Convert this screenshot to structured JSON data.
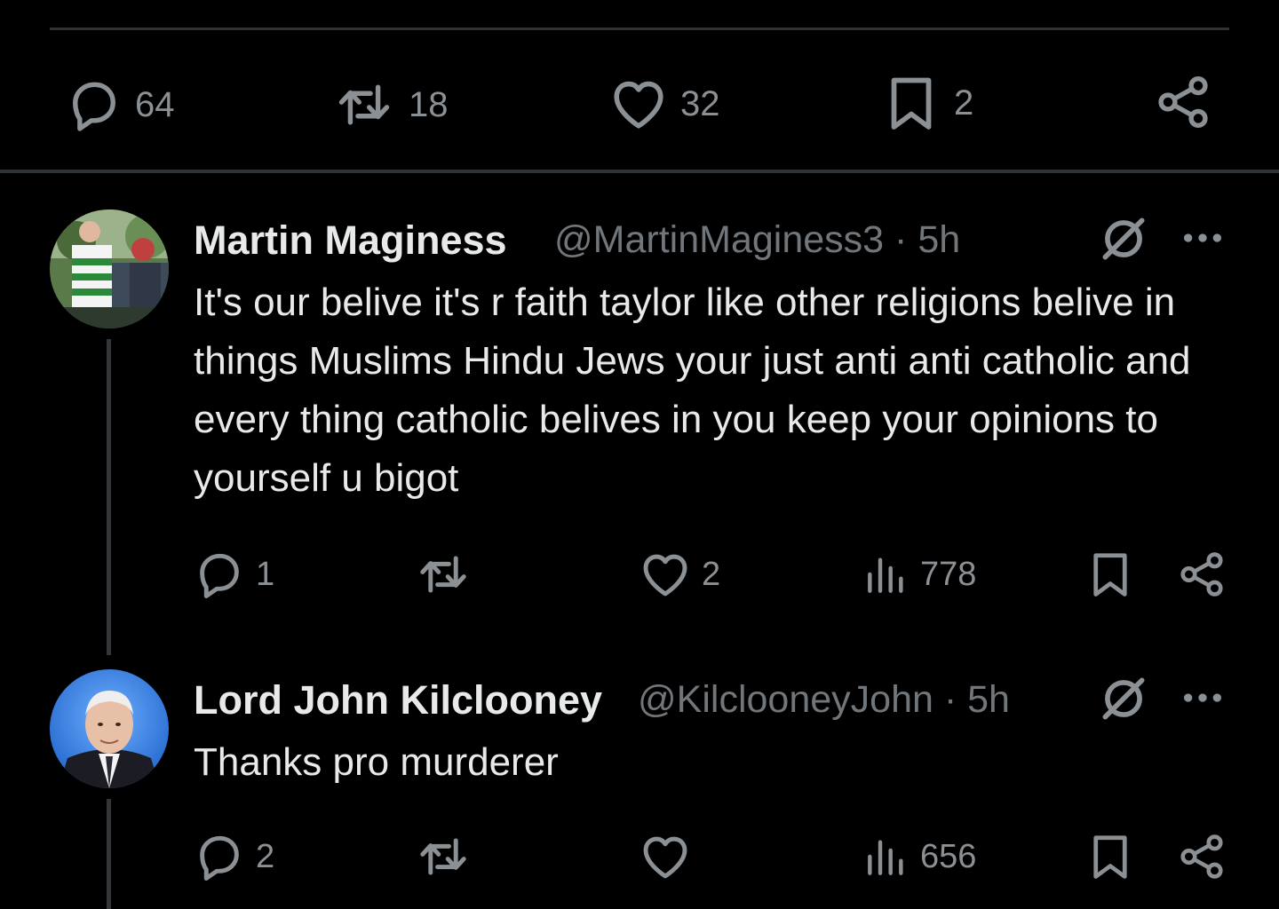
{
  "main_tweet_actions": {
    "replies": "64",
    "reposts": "18",
    "likes": "32",
    "bookmarks": "2"
  },
  "replies": [
    {
      "display_name": "Martin Maginess",
      "handle": "@MartinMaginess3",
      "separator": "·",
      "time": "5h",
      "text": "It's our belive it's r faith taylor like other religions belive in things Muslims Hindu Jews your just anti anti catholic and every thing catholic belives in you keep your opinions to yourself u bigot",
      "reply_count": "1",
      "repost_count": "",
      "like_count": "2",
      "view_count": "778"
    },
    {
      "display_name": "Lord John Kilclooney",
      "handle": "@KilclooneyJohn",
      "separator": "·",
      "time": "5h",
      "text": "Thanks pro murderer",
      "reply_count": "2",
      "repost_count": "",
      "like_count": "",
      "view_count": "656"
    }
  ],
  "colors": {
    "background": "#000000",
    "text_primary": "#e7e9ea",
    "text_secondary": "#71767b",
    "divider": "#2f3336"
  }
}
